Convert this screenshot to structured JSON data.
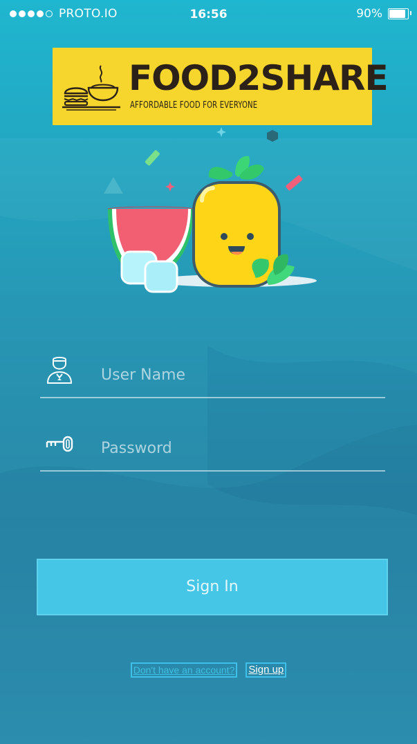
{
  "status_bar": {
    "carrier": "PROTO.IO",
    "time": "16:56",
    "battery": "90%",
    "battery_level": 0.9,
    "signal_dots_filled": 4,
    "signal_dots_total": 5
  },
  "logo": {
    "title": "FOOD2SHARE",
    "tagline": "AFFORDABLE FOOD FOR EVERYONE",
    "icon": "food-plate-icon",
    "background_color": "#f6d62c"
  },
  "illustration": {
    "icon": "fruit-mascot-illustration"
  },
  "login_form": {
    "username": {
      "placeholder": "User Name",
      "value": "",
      "icon": "user-icon"
    },
    "password": {
      "placeholder": "Password",
      "value": "",
      "icon": "key-icon"
    },
    "sign_in_label": "Sign In"
  },
  "footer": {
    "no_account_text": "Don't have an account?",
    "sign_up_label": "Sign up"
  },
  "colors": {
    "accent": "#45c6e6",
    "background_top": "#1fb6cf",
    "background_bottom": "#2a88a8"
  }
}
